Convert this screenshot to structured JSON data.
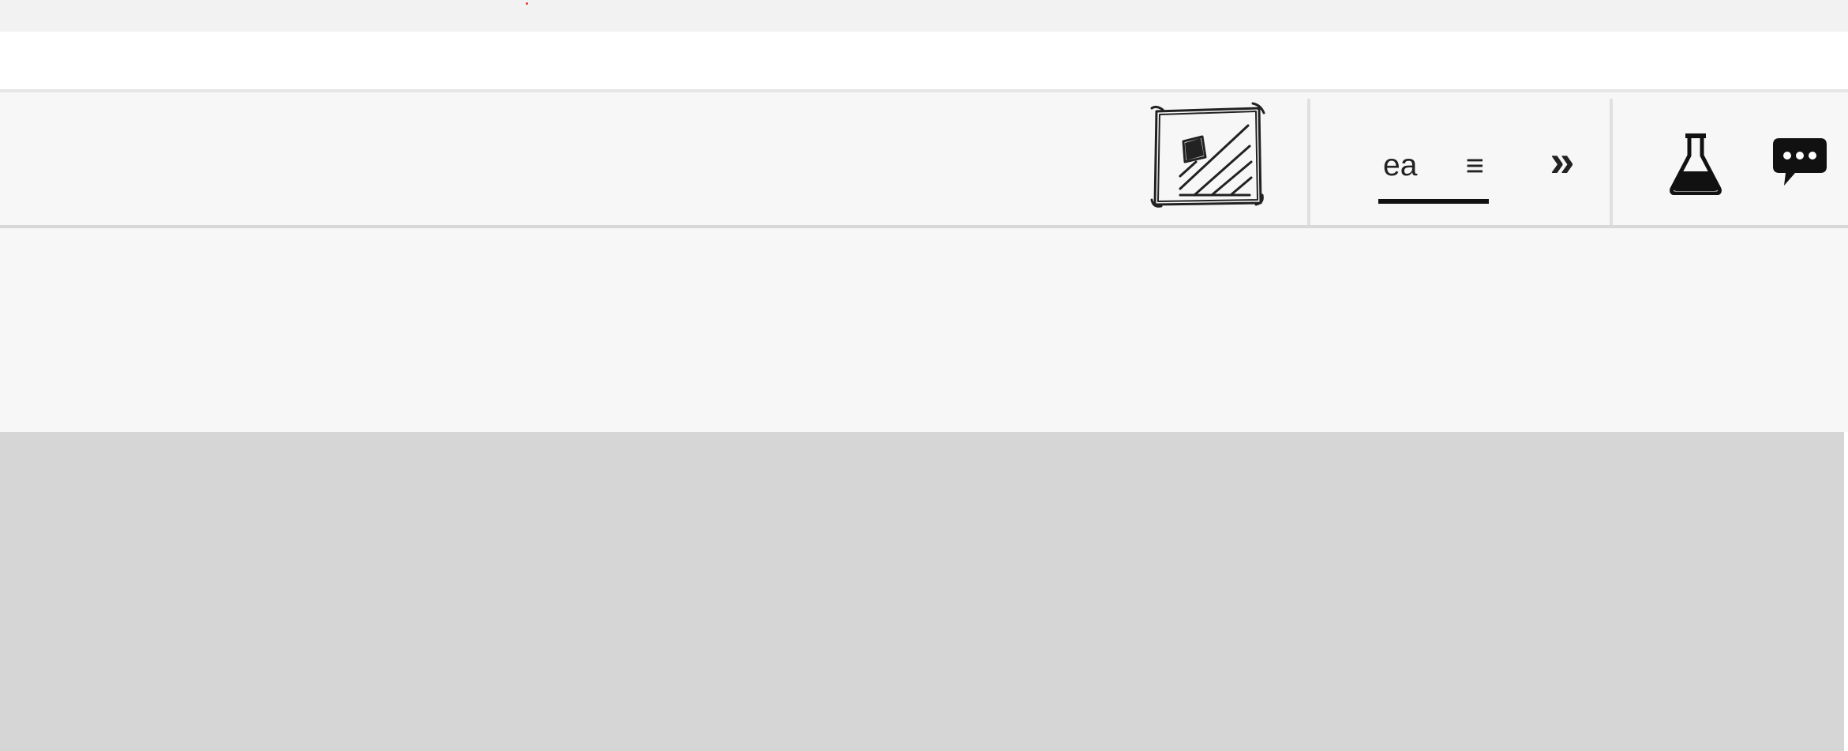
{
  "toolbar": {
    "sketch_icon": "sketch-image-icon",
    "active_tab": {
      "label": "ea",
      "menu_glyph": "≡"
    },
    "overflow_glyph": "»",
    "lab_icon": "flask-icon",
    "comments_icon": "chat-bubble-icon"
  },
  "colors": {
    "background": "#f7f7f7",
    "content_area": "#d6d6d6",
    "accent_underline": "#111111",
    "indicator_dot": "#e53935"
  }
}
